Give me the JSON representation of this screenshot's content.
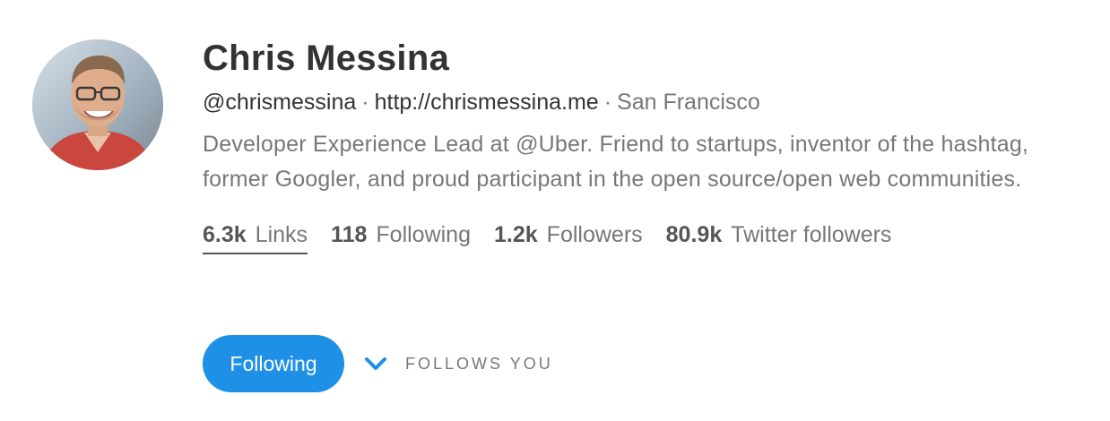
{
  "profile": {
    "name": "Chris Messina",
    "handle": "@chrismessina",
    "website": "http://chrismessina.me",
    "location": "San Francisco",
    "separator": "·",
    "bio": "Developer Experience Lead at @Uber. Friend to startups, inventor of the hashtag, former Googler, and proud participant in the open source/open web communities."
  },
  "stats": [
    {
      "count": "6.3k",
      "label": "Links",
      "active": true
    },
    {
      "count": "118",
      "label": "Following",
      "active": false
    },
    {
      "count": "1.2k",
      "label": "Followers",
      "active": false
    },
    {
      "count": "80.9k",
      "label": "Twitter followers",
      "active": false
    }
  ],
  "actions": {
    "follow_button_label": "Following",
    "follows_you_label": "FOLLOWS YOU",
    "chevron_icon": "chevron-down-icon"
  },
  "colors": {
    "accent": "#1e90e6",
    "text_primary": "#333333",
    "text_secondary": "#777777"
  }
}
